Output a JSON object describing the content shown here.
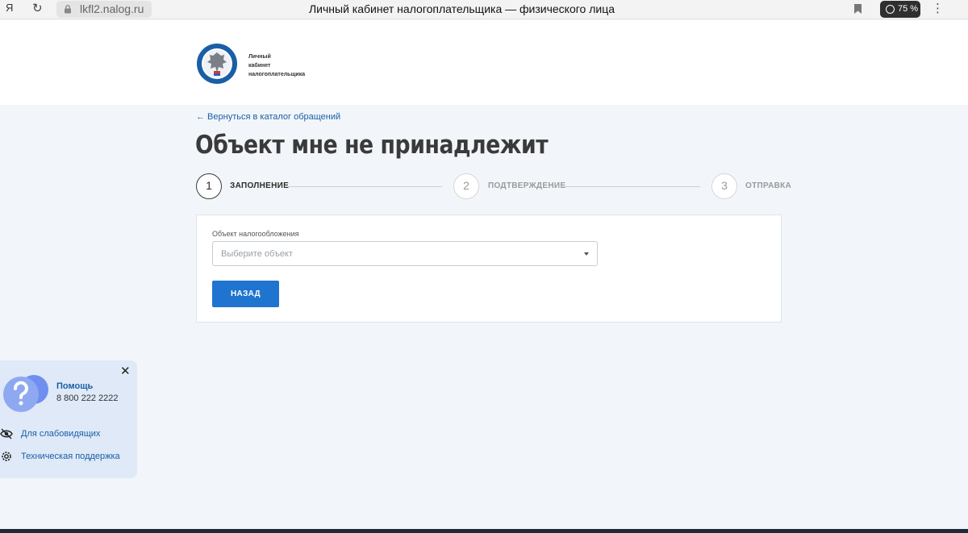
{
  "browser": {
    "logo": "Я",
    "url": "lkfl2.nalog.ru",
    "tab_title": "Личный кабинет налогоплательщика — физического лица",
    "zoom": "75 %"
  },
  "header": {
    "logo_text": [
      "Личный",
      "кабинет",
      "налогоплательщика"
    ]
  },
  "main": {
    "back_link": "← Вернуться в каталог обращений",
    "title": "Объект мне не принадлежит",
    "steps": [
      {
        "number": "1",
        "label": "ЗАПОЛНЕНИЕ",
        "active": true
      },
      {
        "number": "2",
        "label": "ПОДТВЕРЖДЕНИЕ",
        "active": false
      },
      {
        "number": "3",
        "label": "ОТПРАВКА",
        "active": false
      }
    ],
    "form": {
      "field_label": "Объект налогообложения",
      "select_placeholder": "Выберите объект",
      "back_button": "НАЗАД"
    }
  },
  "help": {
    "title": "Помощь",
    "phone": "8 800 222 2222",
    "links": [
      {
        "label": "Для слабовидящих",
        "icon": "eye-slash-icon"
      },
      {
        "label": "Техническая поддержка",
        "icon": "gear-icon"
      }
    ]
  },
  "colors": {
    "accent": "#1f74cf",
    "link": "#1a5fa6",
    "page_bg": "#f2f6fa",
    "help_bg": "#dfe9f7"
  }
}
